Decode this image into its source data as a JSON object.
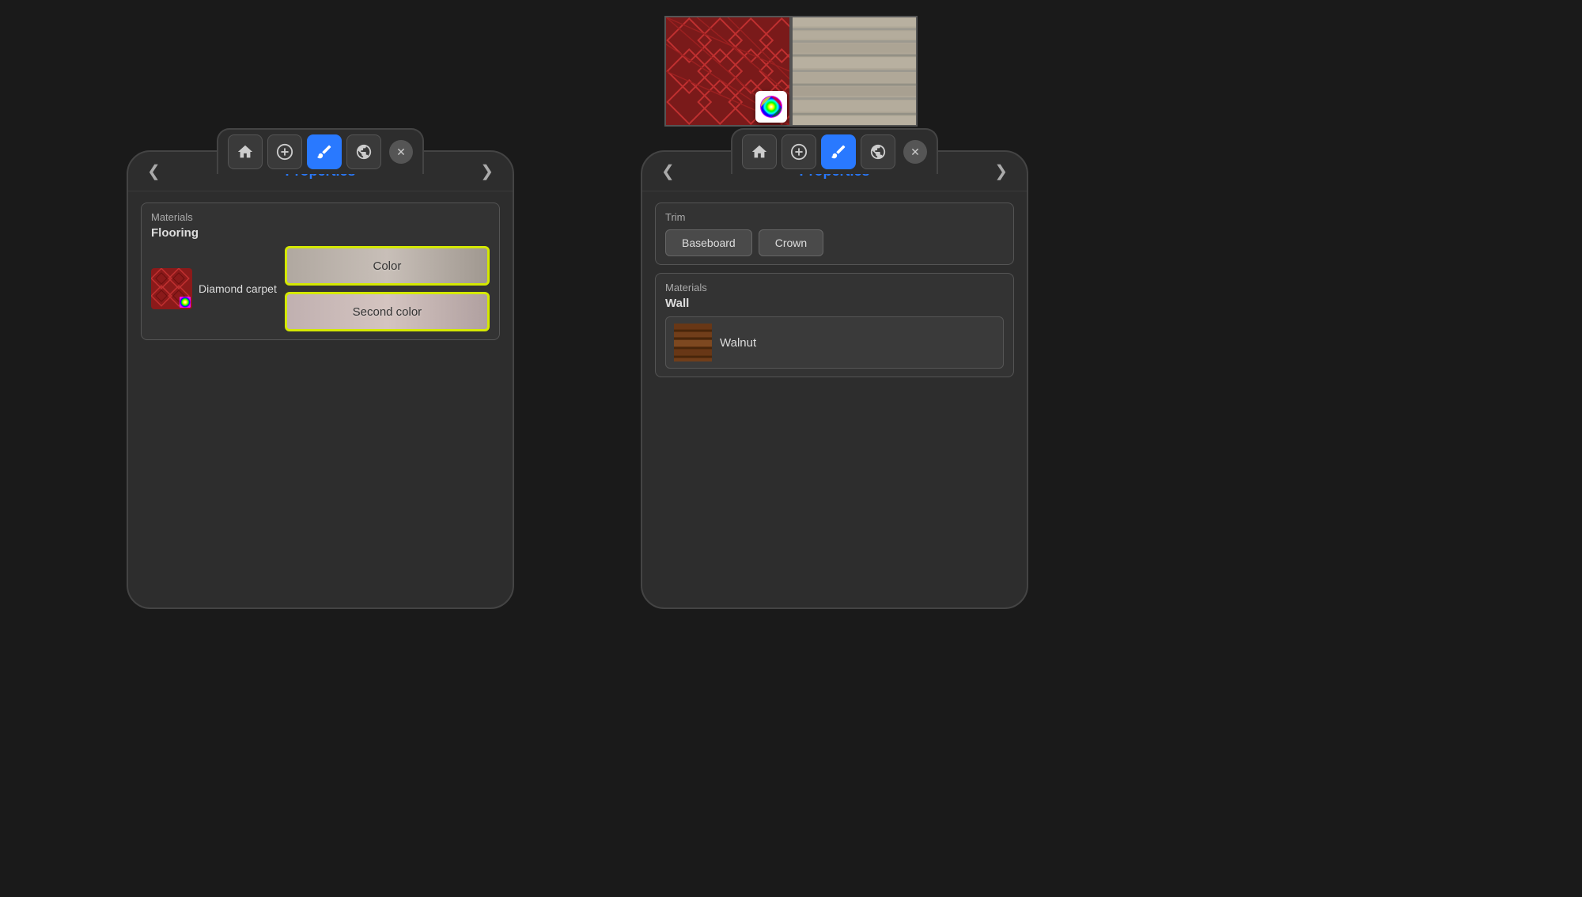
{
  "top_thumbnails": {
    "carpet": {
      "alt": "Diamond carpet texture thumbnail"
    },
    "wood": {
      "alt": "Wood flooring texture thumbnail"
    },
    "color_icon_alt": "Color picker icon"
  },
  "panel_left": {
    "toolbar": {
      "home_label": "🏠",
      "add_label": "⊕",
      "paint_label": "🖌",
      "globe_label": "🌐",
      "close_label": "✕"
    },
    "nav": {
      "prev_label": "❮",
      "title": "Properties",
      "next_label": "❯"
    },
    "materials_section": {
      "label": "Materials",
      "sublabel": "Flooring",
      "item_name": "Diamond carpet",
      "color_btn_label": "Color",
      "second_color_btn_label": "Second color"
    }
  },
  "panel_right": {
    "toolbar": {
      "home_label": "🏠",
      "add_label": "⊕",
      "paint_label": "🖌",
      "globe_label": "🌐",
      "close_label": "✕"
    },
    "nav": {
      "prev_label": "❮",
      "title": "Properties",
      "next_label": "❯"
    },
    "trim_section": {
      "label": "Trim",
      "baseboard_label": "Baseboard",
      "crown_label": "Crown"
    },
    "materials_section": {
      "label": "Materials",
      "sublabel": "Wall",
      "item_name": "Walnut"
    }
  },
  "colors": {
    "active_blue": "#2979ff",
    "highlight_yellow": "#d4e800",
    "panel_bg": "#2d2d2d",
    "toolbar_bg": "#3a3a3a"
  }
}
